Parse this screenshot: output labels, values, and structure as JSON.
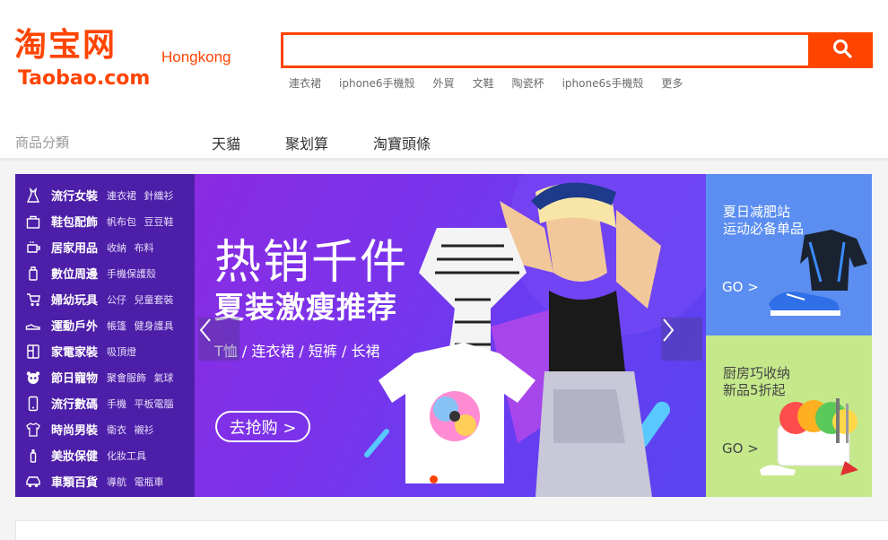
{
  "header": {
    "logo_cn": "淘宝网",
    "logo_en": "Taobao.com",
    "region": "Hongkong",
    "search": {
      "value": "",
      "placeholder": ""
    },
    "hot_words": [
      "連衣裙",
      "iphone6手機殼",
      "外貿",
      "文鞋",
      "陶瓷杯",
      "iphone6s手機殼",
      "更多"
    ]
  },
  "nav": {
    "category_title": "商品分類",
    "links": [
      "天貓",
      "聚划算",
      "淘寶頭條"
    ]
  },
  "categories": [
    {
      "icon": "dress-icon",
      "label": "流行女裝",
      "subs": [
        "連衣裙",
        "針織衫"
      ]
    },
    {
      "icon": "bag-icon",
      "label": "鞋包配飾",
      "subs": [
        "帆布包",
        "豆豆鞋"
      ]
    },
    {
      "icon": "cup-icon",
      "label": "居家用品",
      "subs": [
        "收納",
        "布料"
      ]
    },
    {
      "icon": "phone-accessory-icon",
      "label": "數位周邊",
      "subs": [
        "手機保護殼"
      ]
    },
    {
      "icon": "stroller-icon",
      "label": "婦幼玩具",
      "subs": [
        "公仔",
        "兒童套裝"
      ]
    },
    {
      "icon": "shoe-icon",
      "label": "運動戶外",
      "subs": [
        "帳篷",
        "健身護具"
      ]
    },
    {
      "icon": "fridge-icon",
      "label": "家電家裝",
      "subs": [
        "吸頂燈"
      ]
    },
    {
      "icon": "panda-icon",
      "label": "節日寵物",
      "subs": [
        "聚會服飾",
        "氣球"
      ]
    },
    {
      "icon": "mobile-icon",
      "label": "流行數碼",
      "subs": [
        "手機",
        "平板電腦"
      ]
    },
    {
      "icon": "tshirt-icon",
      "label": "時尚男裝",
      "subs": [
        "衛衣",
        "襯衫"
      ]
    },
    {
      "icon": "bottle-icon",
      "label": "美妝保健",
      "subs": [
        "化妝工具"
      ]
    },
    {
      "icon": "car-icon",
      "label": "車類百貨",
      "subs": [
        "導航",
        "電瓶車"
      ]
    }
  ],
  "banner": {
    "title": "热销千件",
    "subtitle": "夏装激瘦推荐",
    "tags": "T恤 / 连衣裙 / 短裤 / 长裙",
    "cta": "去抢购 >",
    "slide_count": 2,
    "active_slide": 0
  },
  "promos": [
    {
      "line1": "夏日减肥站",
      "line2": "运动必备单品",
      "go": "GO >"
    },
    {
      "line1": "厨房巧收纳",
      "line2": "新品5折起",
      "go": "GO >"
    }
  ],
  "colors": {
    "brand": "#ff4400",
    "sidebar": "#4d1fa8",
    "promo_blue": "#5b8ef0",
    "promo_green": "#c5e88b"
  }
}
